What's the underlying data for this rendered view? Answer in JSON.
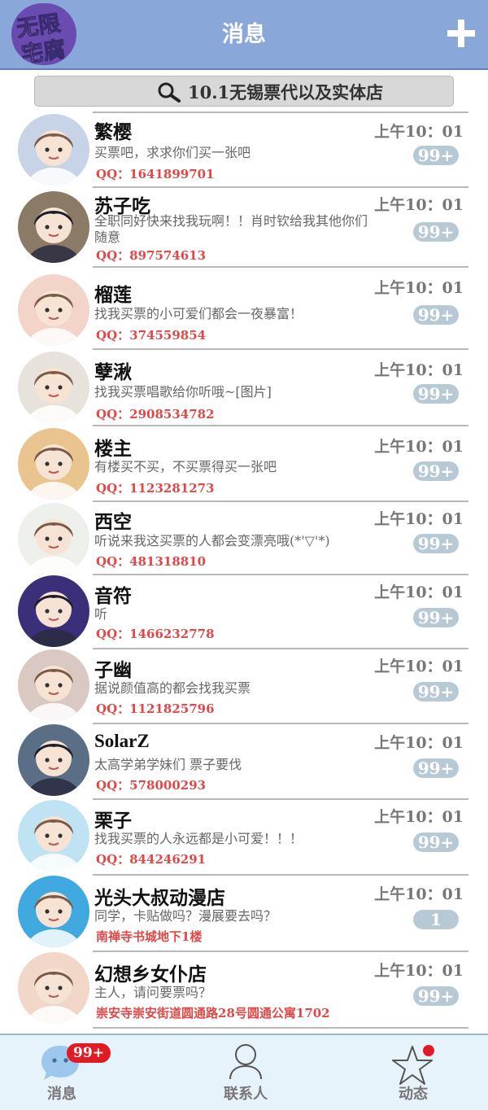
{
  "app": {
    "logo_line1": "无限",
    "logo_line2": "宅腐",
    "title": "消息"
  },
  "search": {
    "text": "10.1无锡票代以及实体店"
  },
  "chats": [
    {
      "name": "繁樱",
      "time": "上午10：01",
      "message": "买票吧，求求你们买一张吧",
      "qq": "QQ：1641899701",
      "badge": "99+",
      "avatar_color": "#c7d3e6"
    },
    {
      "name": "苏子吃",
      "time": "上午10：01",
      "message": "全职同好快来找我玩啊！！肖时钦给我其他你们随意",
      "qq": "QQ：897574613",
      "badge": "99+",
      "avatar_color": "#8b7b66"
    },
    {
      "name": "榴莲",
      "time": "上午10：01",
      "message": "找我买票的小可爱们都会一夜暴富！",
      "qq": "QQ：374559854",
      "badge": "99+",
      "avatar_color": "#f3d4c8"
    },
    {
      "name": "孽湫",
      "time": "上午10：01",
      "message": "找我买票唱歌给你听哦~[图片]",
      "qq": "QQ：2908534782",
      "badge": "99+",
      "avatar_color": "#e8e2dc"
    },
    {
      "name": "楼主",
      "time": "上午10：01",
      "message": "有楼买不买，不买票得买一张吧",
      "qq": "QQ：1123281273",
      "badge": "99+",
      "avatar_color": "#e9c48f"
    },
    {
      "name": "西空",
      "time": "上午10：01",
      "message": "听说来我这买票的人都会变漂亮哦(*'▽'*)",
      "qq": "QQ：481318810",
      "badge": "99+",
      "avatar_color": "#eef0ec"
    },
    {
      "name": "音符",
      "time": "上午10：01",
      "message": "听",
      "qq": "QQ：1466232778",
      "badge": "99+",
      "avatar_color": "#3b2f7a"
    },
    {
      "name": "子幽",
      "time": "上午10：01",
      "message": "据说颜值高的都会找我买票",
      "qq": "QQ：1121825796",
      "badge": "99+",
      "avatar_color": "#d9c9c2"
    },
    {
      "name": "SolarZ",
      "time": "上午10：01",
      "message": "太高学弟学妹们 票子要伐",
      "qq": "QQ：578000293",
      "badge": "99+",
      "avatar_color": "#5a6e86"
    },
    {
      "name": "栗子",
      "time": "上午10：01",
      "message": "找我买票的人永远都是小可爱！！！",
      "qq": "QQ：844246291",
      "badge": "99+",
      "avatar_color": "#bfe3f2"
    },
    {
      "name": "光头大叔动漫店",
      "time": "上午10：01",
      "message": "同学，卡贴做吗？漫展要去吗？",
      "qq": "南禅寺书城地下1楼",
      "badge": "1",
      "avatar_color": "#3fa9e0"
    },
    {
      "name": "幻想乡女仆店",
      "time": "上午10：01",
      "message": "主人，请问要票吗？",
      "qq": "崇安寺崇安街道圆通路28号圆通公寓1702",
      "badge": "99+",
      "avatar_color": "#f0d7c8"
    }
  ],
  "nav": {
    "messages_label": "消息",
    "messages_badge": "99+",
    "contacts_label": "联系人",
    "moments_label": "动态"
  }
}
